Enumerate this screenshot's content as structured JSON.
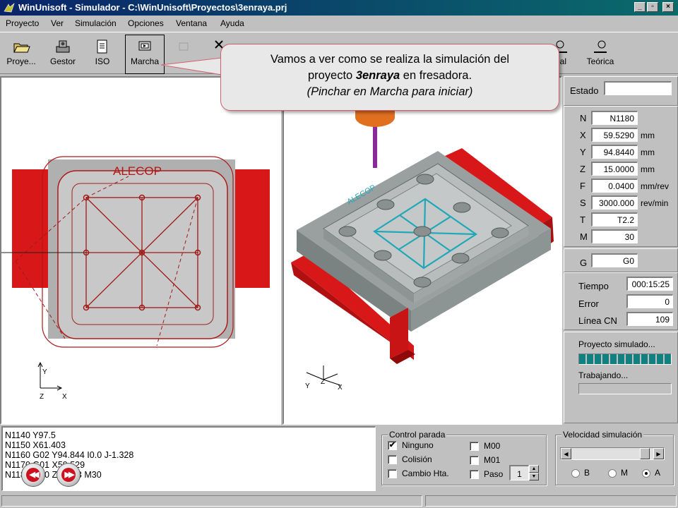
{
  "window": {
    "title": "WinUnisoft - Simulador - C:\\WinUnisoft\\Proyectos\\3enraya.prj",
    "buttons": {
      "minimize": "_",
      "maximize": "▫",
      "close": "×"
    }
  },
  "menu": [
    "Proyecto",
    "Ver",
    "Simulación",
    "Opciones",
    "Ventana",
    "Ayuda"
  ],
  "toolbar": {
    "proyecto": "Proye...",
    "gestor": "Gestor",
    "iso": "ISO",
    "marcha": "Marcha",
    "real": "eal",
    "teorica": "Teórica"
  },
  "callout": {
    "line1": "Vamos a ver como se realiza la simulación del",
    "line2_pre": "proyecto ",
    "line2_bold": "3enraya",
    "line2_post": " en fresadora.",
    "line3": "(Pinchar en Marcha para iniciar)"
  },
  "view2d": {
    "brand": "ALECOP",
    "axis_y": "Y",
    "axis_z": "Z",
    "axis_x": "X"
  },
  "view3d": {
    "axis_y": "Y",
    "axis_z": "Z",
    "axis_x": "X",
    "colors": {
      "vise": "#d81818",
      "base": "#a9aeae",
      "slot": "#20a8b8",
      "tool": "#e07020"
    }
  },
  "panel": {
    "estado_label": "Estado",
    "estado_value": "",
    "rows": [
      {
        "label": "N",
        "value": "N1180",
        "unit": ""
      },
      {
        "label": "X",
        "value": "59.5290",
        "unit": "mm"
      },
      {
        "label": "Y",
        "value": "94.8440",
        "unit": "mm"
      },
      {
        "label": "Z",
        "value": "15.0000",
        "unit": "mm"
      },
      {
        "label": "F",
        "value": "0.0400",
        "unit": "mm/rev"
      },
      {
        "label": "S",
        "value": "3000.000",
        "unit": "rev/min"
      },
      {
        "label": "T",
        "value": "T2.2",
        "unit": ""
      },
      {
        "label": "M",
        "value": "30",
        "unit": ""
      }
    ],
    "g_label": "G",
    "g_value": "G0",
    "tiempo_label": "Tiempo",
    "tiempo_value": "000:15:25",
    "error_label": "Error",
    "error_value": "0",
    "linea_label": "Línea CN",
    "linea_value": "109",
    "proyecto_simulado": "Proyecto simulado...",
    "progress_simulado": 1.0,
    "trabajando": "Trabajando...",
    "progress_trabajando": 0.0
  },
  "code_lines": [
    "N1140 Y97.5",
    "N1150 X61.403",
    "N1160 G02 Y94.844 I0.0 J-1.328",
    "N1170 G01 X59.529",
    "N1180 G00 Z15 M3 M30"
  ],
  "control_parada": {
    "title": "Control parada",
    "ninguno": "Ninguno",
    "colision": "Colisión",
    "cambio": "Cambio Hta.",
    "m00": "M00",
    "m01": "M01",
    "paso": "Paso",
    "paso_value": "1"
  },
  "velocidad": {
    "title": "Velocidad simulación",
    "b": "B",
    "m": "M",
    "a": "A",
    "level": 0.95
  },
  "nav": {
    "prev": "◀◀",
    "next": "▶▶"
  }
}
